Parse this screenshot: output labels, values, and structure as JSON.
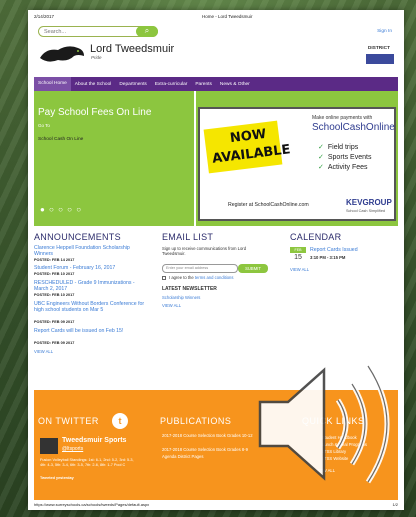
{
  "print_header": {
    "date": "2/14/2017",
    "title": "Home - Lord Tweedsmuir"
  },
  "search": {
    "placeholder": "Search...",
    "button_icon": "search-icon"
  },
  "top": {
    "sign_in": "Sign In",
    "school_name": "Lord Tweedsmuir",
    "motto": "Pride",
    "district_label": "DISTRICT"
  },
  "nav": {
    "items": [
      "School Home",
      "About the School",
      "Departments",
      "Extra-curricular",
      "Parents",
      "News & Other"
    ]
  },
  "banner_left": {
    "title": "Pay School Fees On Line",
    "goto": "Go To",
    "link": "School Cash On Line",
    "dots": "● ○ ○ ○ ○"
  },
  "banner_right": {
    "now": "NOW",
    "available": "AVAILABLE",
    "make_payments": "Make online payments with",
    "brand": "SchoolCashOnline",
    "bullets": [
      "Field trips",
      "Sports Events",
      "Activity Fees"
    ],
    "check": "✓",
    "register": "Register at SchoolCashOnline.com",
    "kev": "KEVGROUP",
    "kev_sub": "School Cash Simplified"
  },
  "announcements": {
    "title": "ANNOUNCEMENTS",
    "items": [
      {
        "title": "Clarence Heppell Foundation Scholarship Winners",
        "posted": "POSTED: FEB 14 2017"
      },
      {
        "title": "Student Forum - February 16, 2017",
        "posted": "POSTED: FEB 10 2017"
      },
      {
        "title": "RESCHEDULED - Grade 9 Immunizations - March 2, 2017",
        "posted": "POSTED: FEB 10 2017"
      },
      {
        "title": "UBC Engineers Without Borders Conference for high school students on Mar 5",
        "posted": "POSTED: FEB 09 2017"
      },
      {
        "title": "Report Cards will be issued on Feb 15!",
        "posted": "POSTED: FEB 09 2017"
      }
    ],
    "view_all": "VIEW ALL"
  },
  "email": {
    "title": "EMAIL LIST",
    "desc": "Sign up to receive communications from Lord Tweedsmuir.",
    "input_placeholder": "Enter your email address",
    "submit": "SUBMIT",
    "agree_prefix": "I agree to the ",
    "agree_link": "terms and conditions",
    "newsletter_title": "LATEST NEWSLETTER",
    "newsletter_link": "Scholarship Winners",
    "view_all": "VIEW ALL"
  },
  "calendar": {
    "title": "CALENDAR",
    "month": "FEB",
    "day": "15",
    "event": "Report Cards Issued",
    "time": "3:10 PM - 3:15 PM",
    "view_all": "VIEW ALL"
  },
  "footer": {
    "twitter_title": "ON TWITTER",
    "twitter_icon_char": "t",
    "tw_name": "Tweedsmuir Sports",
    "tw_handle": "@ltsports",
    "tw_body": "Fusion Volleyball Standings: 1st: 6-1, 2nd: 5-2, 3rd: 5-3, 4th: 4-3, 5th: 3-4, 6th: 3-5, 7th: 2-6, 8th: 1-7 Pool C",
    "tw_when": "Tweeted yesterday",
    "publications_title": "PUBLICATIONS",
    "publications": [
      "2017-2018 Course Selection Book Grades 10-12",
      "2017-2018 Course Selection Book Grades 8-9",
      "Agenda District Pages"
    ],
    "quicklinks_title": "QUICK LINKS",
    "quicklinks": [
      "Student Handbook",
      "Lunch & Meal Programs",
      "LTSS Library",
      "LTSS Website"
    ],
    "view_all": "VIEW ALL"
  },
  "print_footer": {
    "url": "https://www.surreyschools.ca/schools/tweeds/Pages/default.aspx",
    "page": "1/2"
  },
  "colors": {
    "green": "#8dc63f",
    "purple": "#5b2a86",
    "orange": "#f7941d",
    "link": "#3a7bd5",
    "heading": "#2b2b6b"
  }
}
